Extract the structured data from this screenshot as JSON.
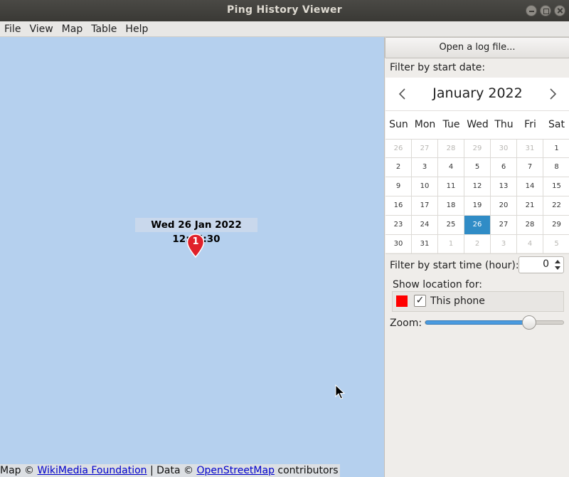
{
  "window": {
    "title": "Ping History Viewer"
  },
  "menu": [
    "File",
    "View",
    "Map",
    "Table",
    "Help"
  ],
  "map": {
    "marker_label": "Wed 26 Jan 2022 12:35:30",
    "marker_number": "1",
    "marker_color": "#e0202a",
    "background_color": "#b5d0ee",
    "attribution": {
      "prefix": "Map © ",
      "link1": "WikiMedia Foundation",
      "middle": " | Data © ",
      "link2": "OpenStreetMap",
      "suffix": " contributors"
    }
  },
  "panel": {
    "open_button": "Open a log file...",
    "filter_date_label": "Filter by start date:",
    "calendar": {
      "month": "January 2022",
      "prev_icon": "chevron-left-icon",
      "next_icon": "chevron-right-icon",
      "weekdays": [
        "Sun",
        "Mon",
        "Tue",
        "Wed",
        "Thu",
        "Fri",
        "Sat"
      ],
      "weeks": [
        [
          {
            "d": "26",
            "m": true
          },
          {
            "d": "27",
            "m": true
          },
          {
            "d": "28",
            "m": true
          },
          {
            "d": "29",
            "m": true
          },
          {
            "d": "30",
            "m": true
          },
          {
            "d": "31",
            "m": true
          },
          {
            "d": "1"
          }
        ],
        [
          {
            "d": "2"
          },
          {
            "d": "3"
          },
          {
            "d": "4"
          },
          {
            "d": "5"
          },
          {
            "d": "6"
          },
          {
            "d": "7"
          },
          {
            "d": "8"
          }
        ],
        [
          {
            "d": "9"
          },
          {
            "d": "10"
          },
          {
            "d": "11"
          },
          {
            "d": "12"
          },
          {
            "d": "13"
          },
          {
            "d": "14"
          },
          {
            "d": "15"
          }
        ],
        [
          {
            "d": "16"
          },
          {
            "d": "17"
          },
          {
            "d": "18"
          },
          {
            "d": "19"
          },
          {
            "d": "20"
          },
          {
            "d": "21"
          },
          {
            "d": "22"
          }
        ],
        [
          {
            "d": "23"
          },
          {
            "d": "24"
          },
          {
            "d": "25"
          },
          {
            "d": "26",
            "s": true
          },
          {
            "d": "27"
          },
          {
            "d": "28"
          },
          {
            "d": "29"
          }
        ],
        [
          {
            "d": "30"
          },
          {
            "d": "31"
          },
          {
            "d": "1",
            "m": true
          },
          {
            "d": "2",
            "m": true
          },
          {
            "d": "3",
            "m": true
          },
          {
            "d": "4",
            "m": true
          },
          {
            "d": "5",
            "m": true
          }
        ]
      ],
      "selected_color": "#308cc6"
    },
    "filter_time_label": "Filter by start time (hour):",
    "filter_time_value": "0",
    "show_location_label": "Show location for:",
    "location": {
      "name": "This phone",
      "checked": true,
      "check_glyph": "✓",
      "color": "#ff0000"
    },
    "zoom_label": "Zoom:",
    "zoom_fraction": 0.75
  }
}
